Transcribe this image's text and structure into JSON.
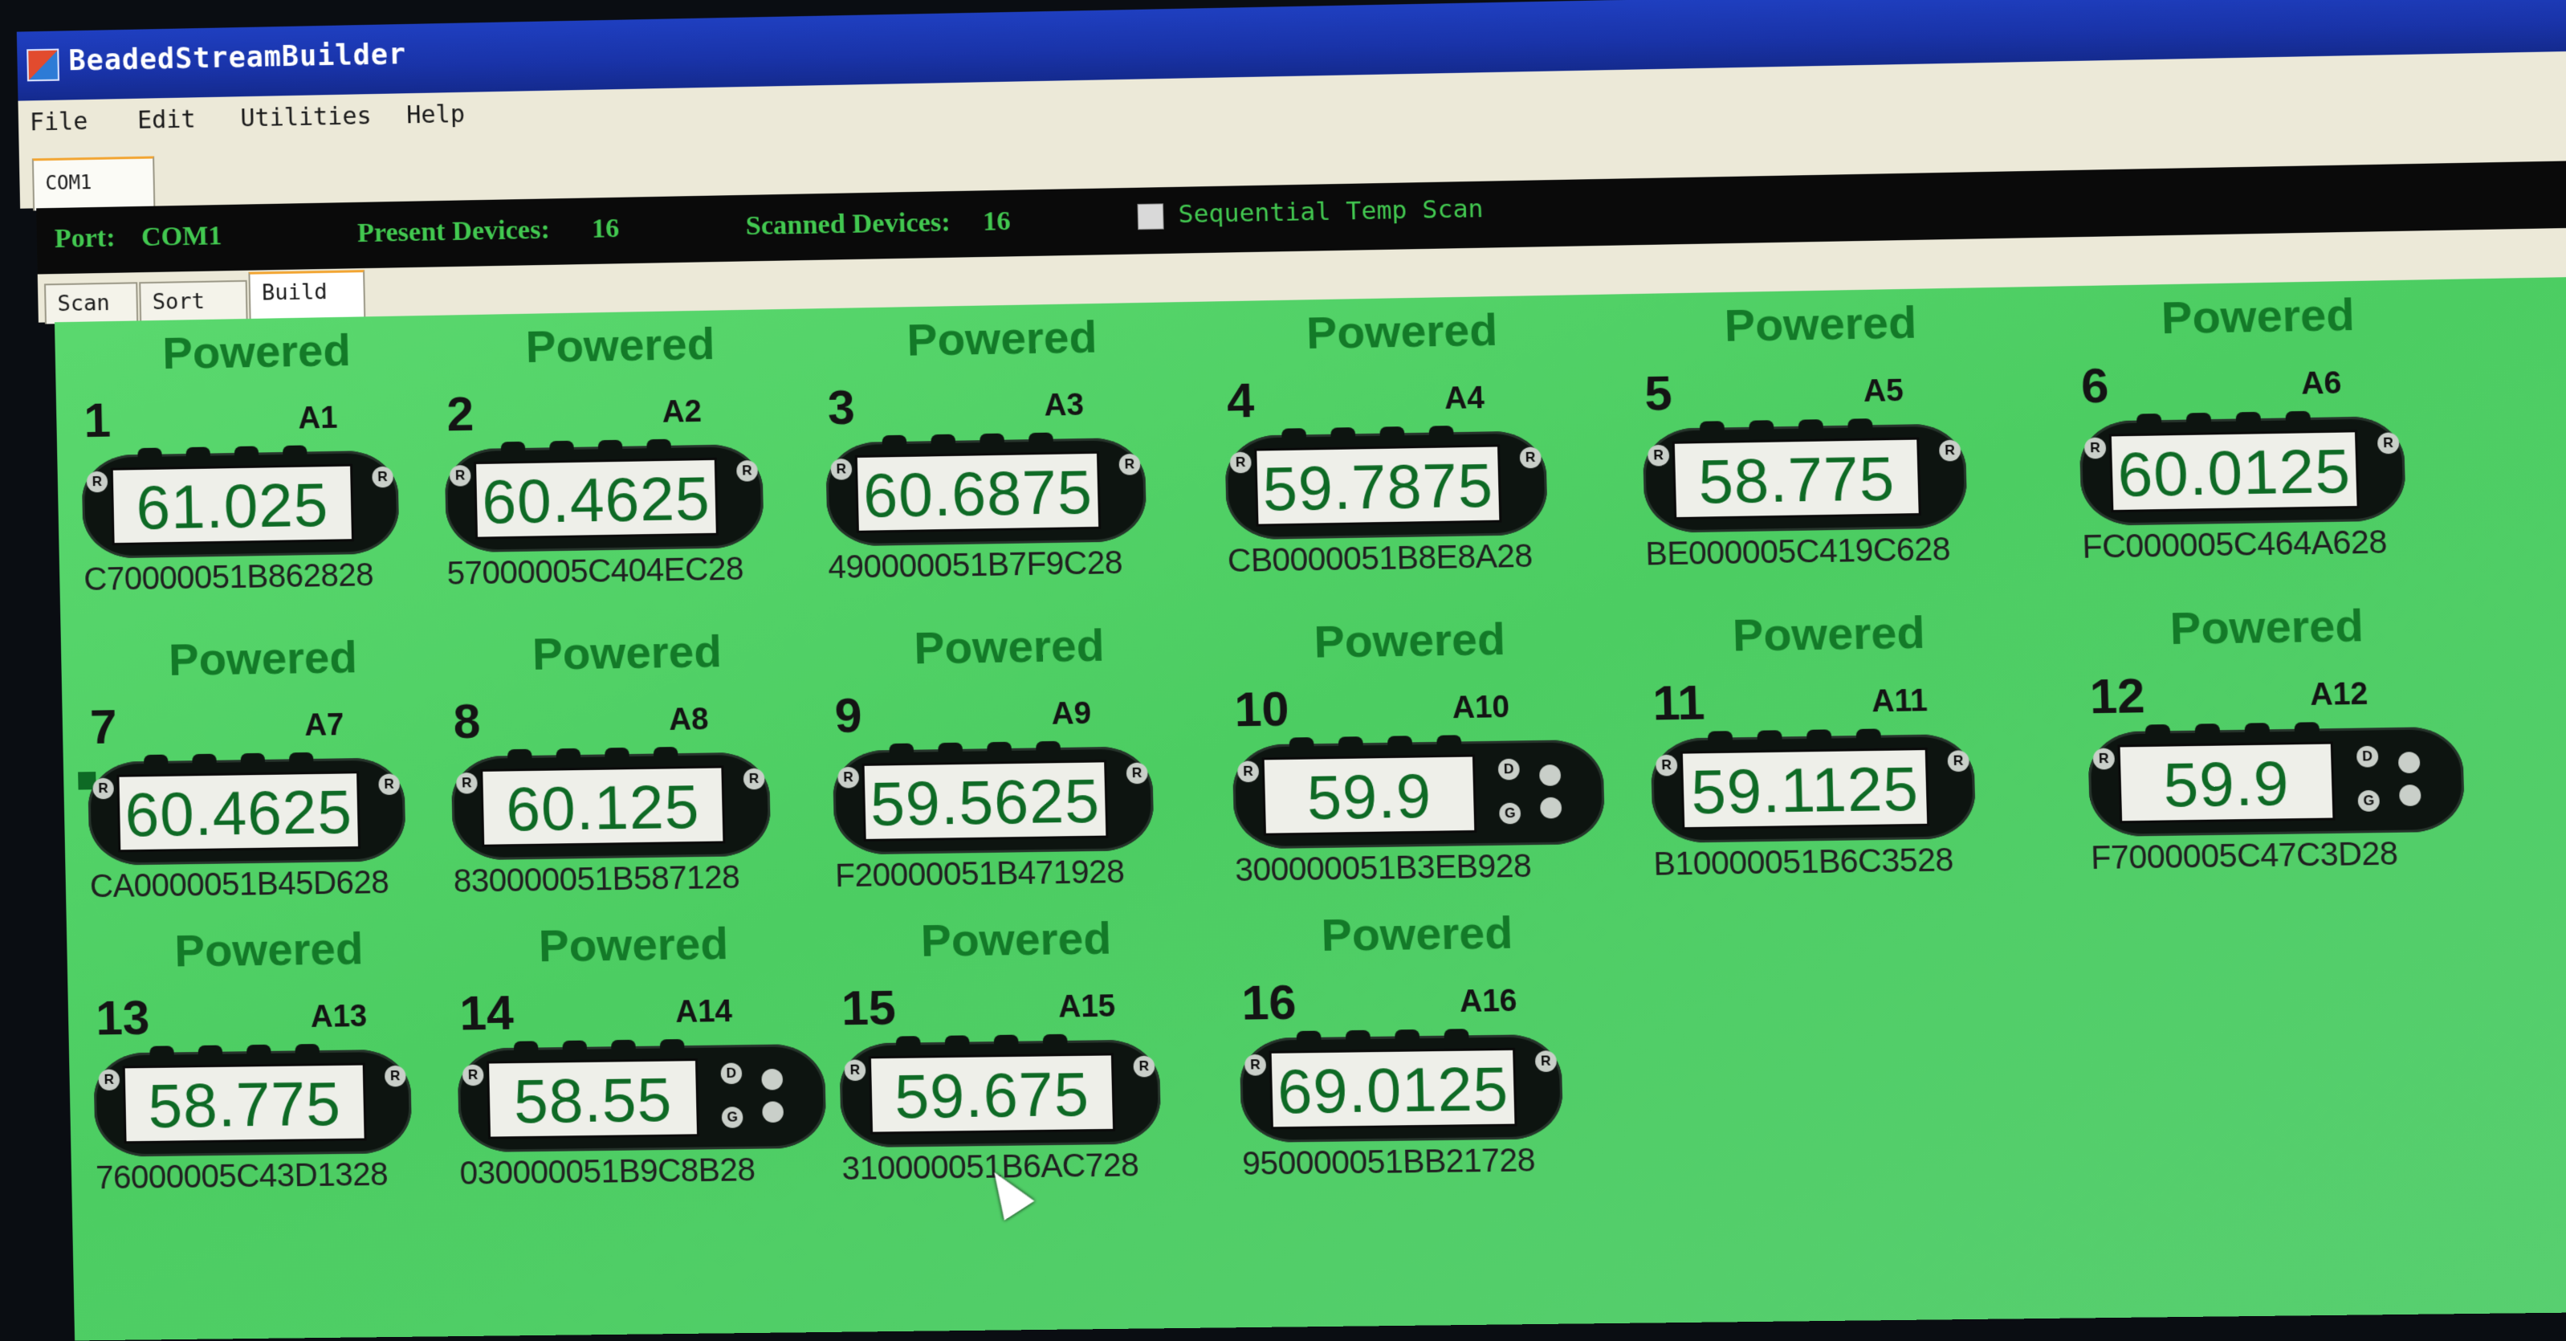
{
  "window": {
    "title": "BeadedStreamBuilder"
  },
  "menu": [
    "File",
    "Edit",
    "Utilities",
    "Help"
  ],
  "port_tab": "COM1",
  "status": {
    "port_label": "Port:",
    "port_value": "COM1",
    "present_label": "Present Devices:",
    "present_value": "16",
    "scanned_label": "Scanned Devices:",
    "scanned_value": "16",
    "sequential_label": "Sequential Temp Scan",
    "sequential_checked": false
  },
  "tabs": [
    {
      "label": "Scan",
      "active": false
    },
    {
      "label": "Sort",
      "active": false
    },
    {
      "label": "Build",
      "active": true
    }
  ],
  "board_colors": {
    "panel": "#4ccd62",
    "status_text": "#42c850",
    "temp_text": "#0e6a25"
  },
  "devices": [
    {
      "num": "1",
      "addr": "A1",
      "status": "Powered",
      "temp": "61.025",
      "serial": "C70000051B862828",
      "board": "std"
    },
    {
      "num": "2",
      "addr": "A2",
      "status": "Powered",
      "temp": "60.4625",
      "serial": "57000005C404EC28",
      "board": "std"
    },
    {
      "num": "3",
      "addr": "A3",
      "status": "Powered",
      "temp": "60.6875",
      "serial": "490000051B7F9C28",
      "board": "std"
    },
    {
      "num": "4",
      "addr": "A4",
      "status": "Powered",
      "temp": "59.7875",
      "serial": "CB0000051B8E8A28",
      "board": "std"
    },
    {
      "num": "5",
      "addr": "A5",
      "status": "Powered",
      "temp": "58.775",
      "serial": "BE000005C419C628",
      "board": "std"
    },
    {
      "num": "6",
      "addr": "A6",
      "status": "Powered",
      "temp": "60.0125",
      "serial": "FC000005C464A628",
      "board": "std"
    },
    {
      "num": "7",
      "addr": "A7",
      "status": "Powered",
      "temp": "60.4625",
      "serial": "CA0000051B45D628",
      "board": "std"
    },
    {
      "num": "8",
      "addr": "A8",
      "status": "Powered",
      "temp": "60.125",
      "serial": "830000051B587128",
      "board": "std"
    },
    {
      "num": "9",
      "addr": "A9",
      "status": "Powered",
      "temp": "59.5625",
      "serial": "F20000051B471928",
      "board": "std"
    },
    {
      "num": "10",
      "addr": "A10",
      "status": "Powered",
      "temp": "59.9",
      "serial": "300000051B3EB928",
      "board": "ext"
    },
    {
      "num": "11",
      "addr": "A11",
      "status": "Powered",
      "temp": "59.1125",
      "serial": "B10000051B6C3528",
      "board": "std"
    },
    {
      "num": "12",
      "addr": "A12",
      "status": "Powered",
      "temp": "59.9",
      "serial": "F7000005C47C3D28",
      "board": "ext"
    },
    {
      "num": "13",
      "addr": "A13",
      "status": "Powered",
      "temp": "58.775",
      "serial": "76000005C43D1328",
      "board": "std"
    },
    {
      "num": "14",
      "addr": "A14",
      "status": "Powered",
      "temp": "58.55",
      "serial": "030000051B9C8B28",
      "board": "ext"
    },
    {
      "num": "15",
      "addr": "A15",
      "status": "Powered",
      "temp": "59.675",
      "serial": "310000051B6AC728",
      "board": "std"
    },
    {
      "num": "16",
      "addr": "A16",
      "status": "Powered",
      "temp": "69.0125",
      "serial": "950000051BB21728",
      "board": "std"
    }
  ]
}
